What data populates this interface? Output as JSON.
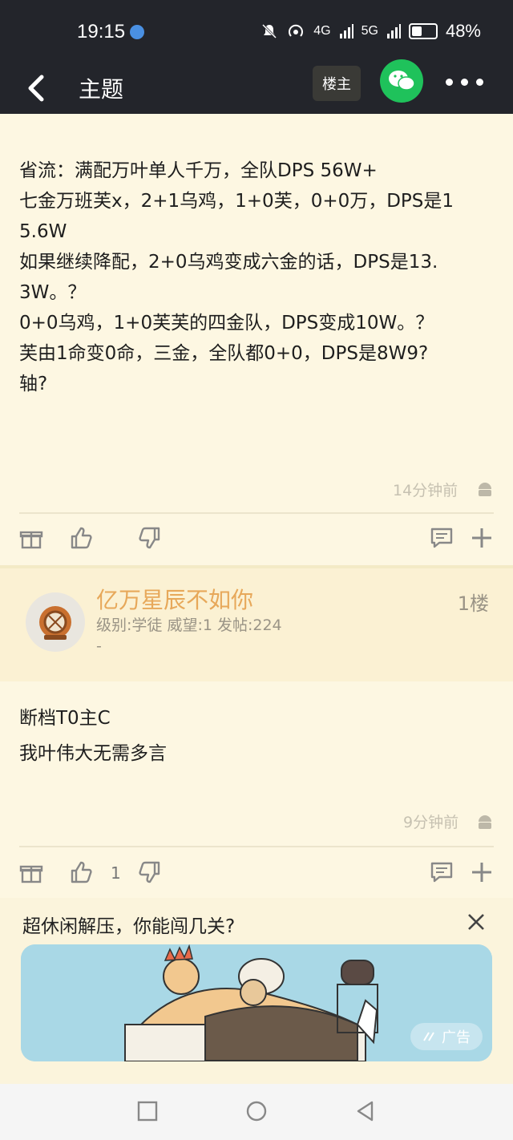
{
  "status": {
    "time": "19:15",
    "net1": "4G",
    "net2": "5G",
    "battery": "48%"
  },
  "header": {
    "title": "主题",
    "owner_button": "楼主"
  },
  "post1": {
    "lines": [
      "省流：满配万叶单人千万，全队DPS 56W+",
      "七金万班芙x，2+1乌鸡，1+0芙，0+0万，DPS是1",
      "5.6W",
      "如果继续降配，2+0乌鸡变成六金的话，DPS是13.",
      "3W。？",
      "0+0乌鸡，1+0芙芙的四金队，DPS变成10W。？",
      "芙由1命变0命，三金，全队都0+0，DPS是8W9?",
      "轴?"
    ],
    "time": "14分钟前"
  },
  "reply1": {
    "username": "亿万星辰不如你",
    "info": "级别:学徒 威望:1 发帖:224",
    "dash": "-",
    "floor": "1楼",
    "lines": [
      "断档T0主C",
      "我叶伟大无需多言"
    ],
    "time": "9分钟前",
    "like_count": "1"
  },
  "ad": {
    "title": "超休闲解压，你能闯几关?",
    "badge": "广告"
  },
  "colors": {
    "dark_bar": "#23252b",
    "bg": "#fbf4dc",
    "username": "#e7a85a",
    "wechat": "#1fc25b"
  }
}
